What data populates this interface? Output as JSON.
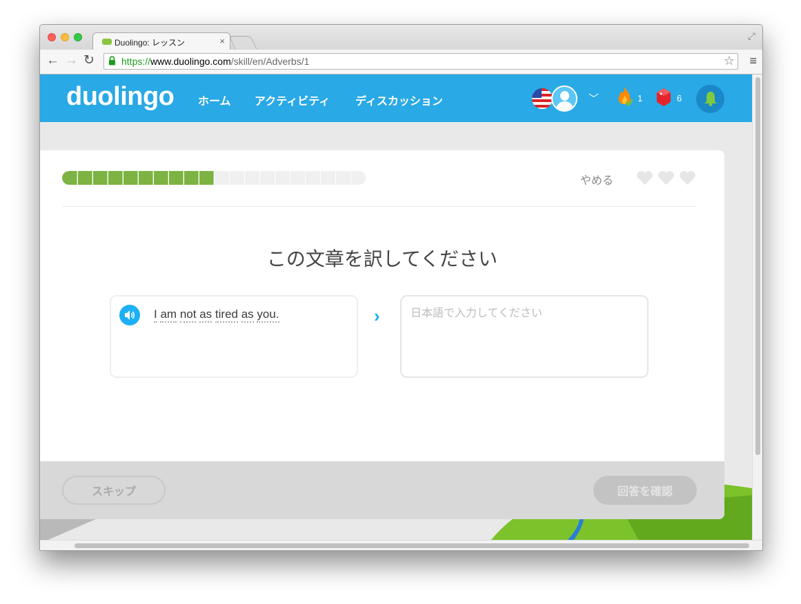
{
  "browser": {
    "tab_title": "Duolingo: レッスン",
    "tab_close": "×",
    "url_proto": "https://",
    "url_host": "www.duolingo.com",
    "url_path": "/skill/en/Adverbs/1"
  },
  "header": {
    "logo": "duolingo",
    "nav": [
      "ホーム",
      "アクティビティ",
      "ディスカッション"
    ],
    "streak_count": "1",
    "gem_count": "6",
    "accent_color": "#29a9e6"
  },
  "lesson": {
    "progress_fraction": 0.5,
    "quit_label": "やめる",
    "hearts": 3,
    "prompt": "この文章を訳してください",
    "sentence_words": [
      "I",
      "am",
      "not",
      "as",
      "tired",
      "as",
      "you."
    ],
    "answer_placeholder": "日本語で入力してください",
    "skip_label": "スキップ",
    "check_label": "回答を確認"
  },
  "icons": [
    "lock-icon",
    "star-icon",
    "menu-icon",
    "flag-icon",
    "avatar-icon",
    "chevron-down-icon",
    "streak-icon",
    "gem-icon",
    "bell-icon",
    "heart-icon",
    "speaker-icon",
    "arrow-icon"
  ]
}
